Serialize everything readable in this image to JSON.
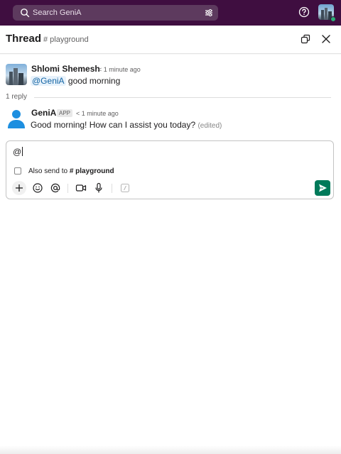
{
  "search": {
    "placeholder": "Search GeniA"
  },
  "thread": {
    "title": "Thread",
    "channel": "# playground"
  },
  "messages": [
    {
      "author": "Shlomi Shemesh",
      "time": "< 1 minute ago",
      "mention": "@GeniA",
      "text": "good morning"
    },
    {
      "author": "GeniA",
      "badge": "APP",
      "time": "< 1 minute ago",
      "text": "Good morning! How can I assist you today?",
      "edited": "(edited)"
    }
  ],
  "replies": {
    "count_label": "1 reply"
  },
  "composer": {
    "value": "@",
    "also_send_label": "Also send to",
    "also_send_channel": "# playground"
  },
  "icons": {
    "search": "search-icon",
    "filter": "filter-icon",
    "help": "help-icon",
    "popout": "popout-icon",
    "close": "close-icon",
    "plus": "plus-icon",
    "emoji": "emoji-icon",
    "mention": "mention-icon",
    "video": "video-icon",
    "mic": "mic-icon",
    "slash": "slash-command-icon",
    "send": "send-icon"
  },
  "colors": {
    "topbar": "#3f0e40",
    "send": "#007a5a",
    "mention": "#1264a3",
    "presence": "#2bac76"
  }
}
